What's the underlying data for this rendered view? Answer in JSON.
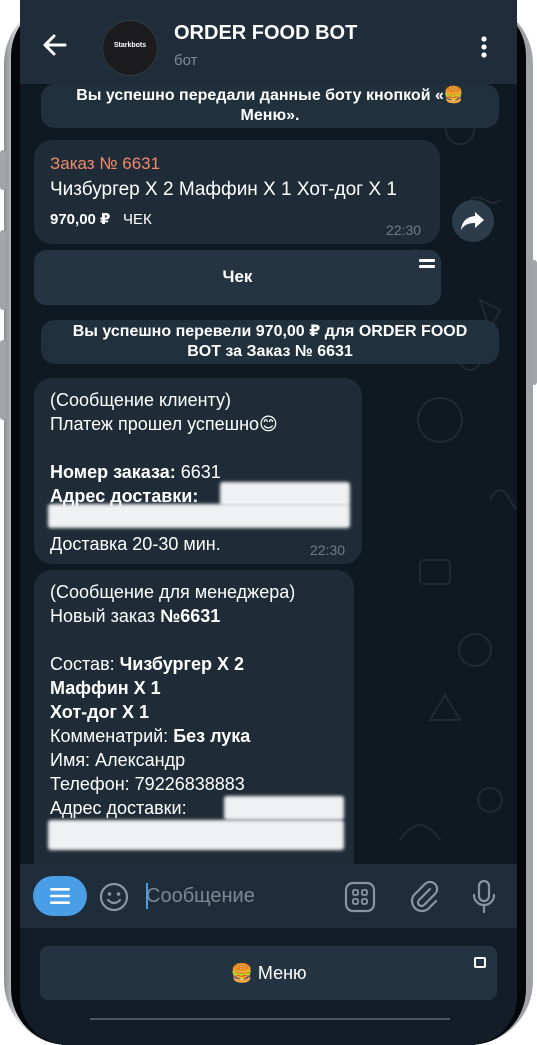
{
  "header": {
    "title": "ORDER FOOD BOT",
    "subtitle": "бот",
    "avatar_text": "Starkbots"
  },
  "messages": {
    "service_1": {
      "line1": "Вы успешно передали данные боту кнопкой «🍔",
      "line2": "Меню»."
    },
    "order": {
      "title": "Заказ № 6631",
      "items": "Чизбургер Х 2 Маффин Х 1 Хот-дог Х 1",
      "price": "970,00 ₽",
      "price_label": "ЧЕК",
      "time": "22:30"
    },
    "check_button": {
      "label": "Чек"
    },
    "service_2": {
      "line1": "Вы успешно перевели 970,00 ₽ для ORDER FOOD",
      "line2": "BOT за Заказ № 6631"
    },
    "client_msg": {
      "line1": "(Сообщение клиенту)",
      "line2": "Платеж прошел успешно😊",
      "order_label": "Номер заказа:",
      "order_value": " 6631",
      "address_label": "Адрес доставки:",
      "delivery": "Доставка 20-30 мин.",
      "time": "22:30"
    },
    "manager_msg": {
      "line1": "(Сообщение для менеджера)",
      "line2_prefix": "Новый заказ ",
      "line2_bold": "№6631",
      "composition_label": "Состав: ",
      "item1": "Чизбургер Х 2",
      "item2": "Маффин Х 1",
      "item3": "Хот-дог Х 1",
      "comment_label": "Комменатрий: ",
      "comment_value": "Без лука",
      "name": "Имя: Александр",
      "phone": "Телефон: 79226838883",
      "address_label": "Адрес доставки: "
    }
  },
  "input": {
    "placeholder": "Сообщение"
  },
  "keyboard": {
    "menu_label": "🍔 Меню"
  },
  "colors": {
    "accent": "#4a9ee8",
    "order_title": "#f08a6c",
    "bubble": "#1f2c38",
    "header": "#1f2d3a",
    "background": "#0f1922"
  },
  "icons": [
    "back-arrow-icon",
    "more-vertical-icon",
    "forward-icon",
    "menu-lines-icon",
    "emoji-icon",
    "commands-icon",
    "attach-icon",
    "mic-icon",
    "open-app-icon"
  ]
}
